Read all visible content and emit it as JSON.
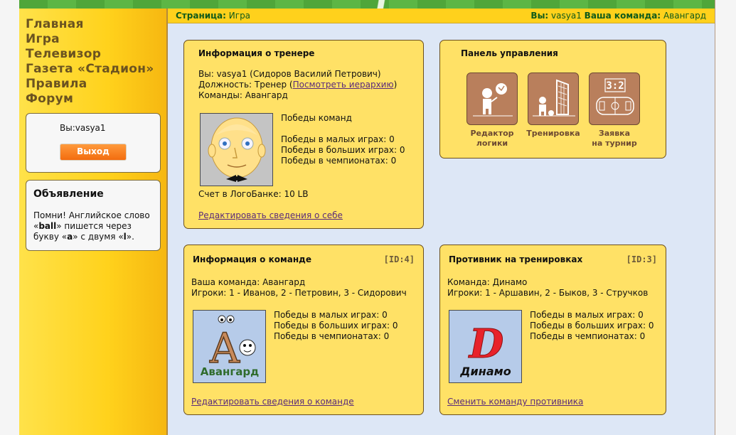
{
  "nav": {
    "items": [
      "Главная",
      "Игра",
      "Телевизор",
      "Газета «Стадион»",
      "Правила",
      "Форум"
    ]
  },
  "login": {
    "you_text": "Вы:vasya1",
    "logout_label": "Выход"
  },
  "ad": {
    "title": "Объявление",
    "text_1": "Помни! Английское слово «",
    "word_ball": "ball",
    "text_2": "» пишется через букву «",
    "letter_a": "a",
    "text_3": "» с двумя «",
    "letter_l": "l",
    "text_4": "»."
  },
  "infobar": {
    "page_label": "Страница:",
    "page_value": "Игра",
    "you_label": "Вы:",
    "you_value": "vasya1",
    "team_label": "Ваша команда:",
    "team_value": "Авангард"
  },
  "coach": {
    "title": "Информация о тренере",
    "you_line": "Вы: vasya1 (Сидоров Василий Петрович)",
    "position_prefix": "Должность: Тренер (",
    "hierarchy_link": "Посмотреть иерархию",
    "position_suffix": ")",
    "teams_line": "Команды: Авангард",
    "wins_heading": "Победы команд",
    "wins_small": "Победы в малых играх: 0",
    "wins_big": "Победы в больших играх: 0",
    "wins_champ": "Победы в чемпионатах: 0",
    "bank": "Счет в ЛогоБанке: 10 LB",
    "edit_link": "Редактировать сведения о себе"
  },
  "control": {
    "title": "Панель управления",
    "buttons": [
      {
        "label_1": "Редактор",
        "label_2": "логики",
        "icon": "robot-logic-icon"
      },
      {
        "label_1": "Тренировка",
        "label_2": "",
        "icon": "training-goal-icon"
      },
      {
        "label_1": "Заявка",
        "label_2": "на турнир",
        "icon": "tournament-scoreboard-icon"
      }
    ],
    "scoreboard_text": "3:2"
  },
  "team": {
    "title": "Информация о команде",
    "id_tag": "[ID:4]",
    "team_line": "Ваша команда: Авангард",
    "players_line": "Игроки: 1 - Иванов, 2 - Петровин, 3 - Сидорович",
    "wins_small": "Победы в малых играх: 0",
    "wins_big": "Победы в больших играх: 0",
    "wins_champ": "Победы в чемпионатах: 0",
    "logo_letter": "А",
    "logo_name": "Авангард",
    "edit_link": "Редактировать сведения о команде"
  },
  "rival": {
    "title": "Противник на тренировках",
    "id_tag": "[ID:3]",
    "team_line": "Команда: Динамо",
    "players_line": "Игроки: 1 - Аршавин, 2 - Быков, 3 - Стручков",
    "wins_small": "Победы в малых играх: 0",
    "wins_big": "Победы в больших играх: 0",
    "wins_champ": "Победы в чемпионатах: 0",
    "logo_letter": "D",
    "logo_name": "Динамо",
    "change_link": "Сменить команду противника"
  },
  "colors": {
    "sidebar": "#ffd21c",
    "card": "#ffe166",
    "main_bg": "#dde7f6",
    "nav_text": "#6b5320",
    "logout": "#f36c0f",
    "control_button": "#b97f5c",
    "link": "#5a2b7a",
    "dinamo_red": "#e8222a",
    "avangard_green": "#2f6b2c"
  }
}
